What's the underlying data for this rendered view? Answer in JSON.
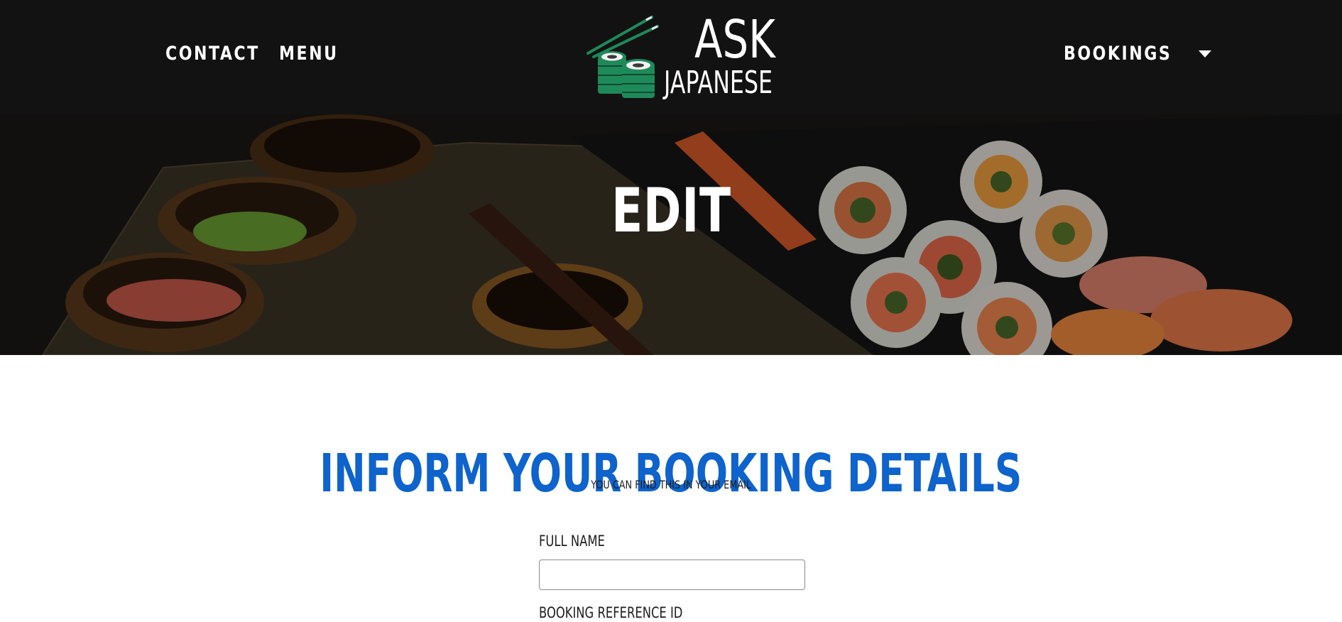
{
  "nav": {
    "contact_label": "CONTACT",
    "menu_label": "MENU",
    "bookings_label": "BOOKINGS"
  },
  "logo": {
    "line1": "ASK",
    "line2": "JAPANESE"
  },
  "hero": {
    "title": "EDIT"
  },
  "form": {
    "heading": "INFORM YOUR BOOKING DETAILS",
    "subheading": "YOU CAN FIND THIS IN YOUR EMAIL",
    "full_name_label": "FULL NAME",
    "full_name_value": "",
    "reference_label": "BOOKING REFERENCE ID"
  },
  "colors": {
    "navbar_bg": "#121212",
    "accent_blue": "#0e63cc",
    "logo_green": "#1e8a5a"
  }
}
